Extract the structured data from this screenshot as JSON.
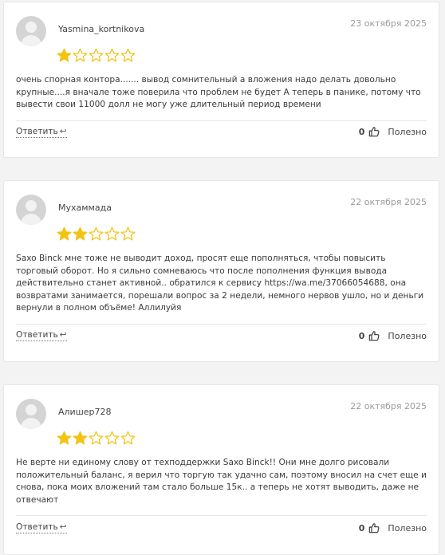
{
  "reviews": [
    {
      "author": "Yasmina_kortnikova",
      "date": "23 октября 2025",
      "rating": 1,
      "max_rating": 5,
      "text": "очень спорная контора....... вывод сомнительный а вложения надо делать довольно крупные....я вначале тоже поверила что проблем не будет А теперь в панике, потому что вывести свои 11000 долл не могу уже длительный период времени",
      "reply_label": "Ответить",
      "likes": "0",
      "helpful_label": "Полезно"
    },
    {
      "author": "Мухаммада",
      "date": "22 октября 2025",
      "rating": 2,
      "max_rating": 5,
      "text_before_link": "Saxo Binck мне тоже не выводит доход, просят еще пополняться, чтобы повысить торговый оборот. Но я сильно сомневаюсь что после пополнения функция вывода действительно станет активной.. обратился к сервису ",
      "link": "https://wa.me/37066054688",
      "text_after_link": ", она возвратами занимается, порешали вопрос за 2 недели, немного нервов ушло, но и деньги вернули в полном объёме! Аллилуйя",
      "reply_label": "Ответить",
      "likes": "0",
      "helpful_label": "Полезно"
    },
    {
      "author": "Алишер728",
      "date": "22 октября 2025",
      "rating": 2,
      "max_rating": 5,
      "text": "Не верте ни единому слову от техподдержки Saxo Binck!! Они мне долго рисовали положительный баланс, я верил что торгую так удачно сам, поэтому вносил на счет еще и снова, пока моих вложений там стало больше 15к.. а теперь не хотят выводить, даже не отвечают",
      "reply_label": "Ответить",
      "likes": "0",
      "helpful_label": "Полезно"
    }
  ],
  "colors": {
    "star_filled": "#f2c311",
    "star_empty_stroke": "#f2c311",
    "date": "#9a9a9a",
    "card_border": "#e6e6e6"
  },
  "icons": {
    "reply": "reply-arrow-icon",
    "like": "thumbs-up-icon",
    "avatar": "user-placeholder-icon",
    "star": "star-icon"
  }
}
